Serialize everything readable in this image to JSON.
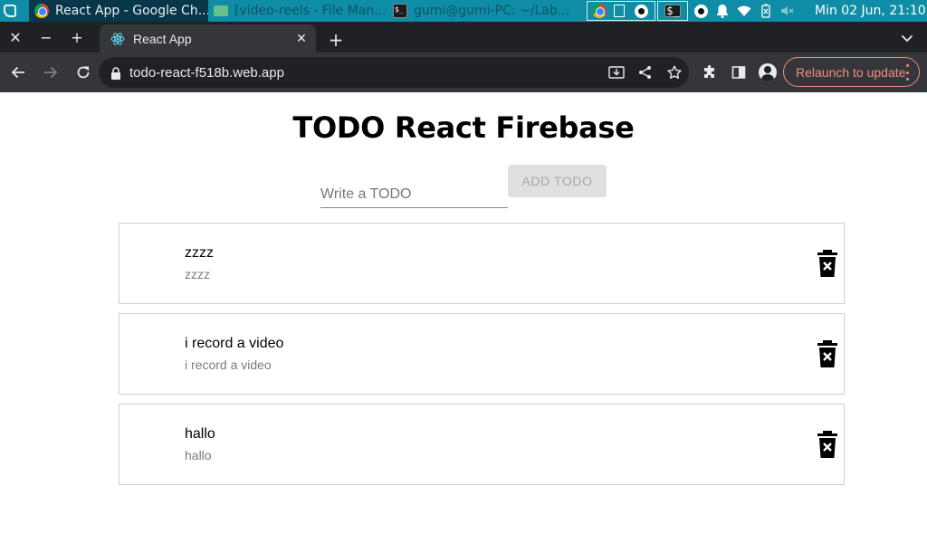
{
  "taskbar": {
    "tasks": [
      {
        "label": "React App - Google Ch...",
        "icon": "chrome-icon"
      },
      {
        "label": "[video-reels - File Man...",
        "icon": "folder-icon"
      },
      {
        "label": "gumi@gumi-PC: ~/Lab...",
        "icon": "terminal-icon"
      }
    ],
    "clock": "Min 02 Jun, 21:10",
    "terminal_glyph": "$_"
  },
  "browser": {
    "tab_title": "React App",
    "url": "todo-react-f518b.web.app",
    "relaunch_label": "Relaunch to update"
  },
  "app": {
    "title": "TODO React Firebase",
    "input_placeholder": "Write a TODO",
    "input_value": "",
    "add_button_label": "ADD TODO",
    "todos": [
      {
        "primary": "zzzz",
        "secondary": "zzzz"
      },
      {
        "primary": "i record a video",
        "secondary": "i record a video"
      },
      {
        "primary": "hallo",
        "secondary": "hallo"
      }
    ]
  },
  "colors": {
    "taskbar": "#0f8da6",
    "tabstrip": "#202124",
    "toolbar": "#35363a",
    "relaunch_accent": "#f28b82"
  }
}
